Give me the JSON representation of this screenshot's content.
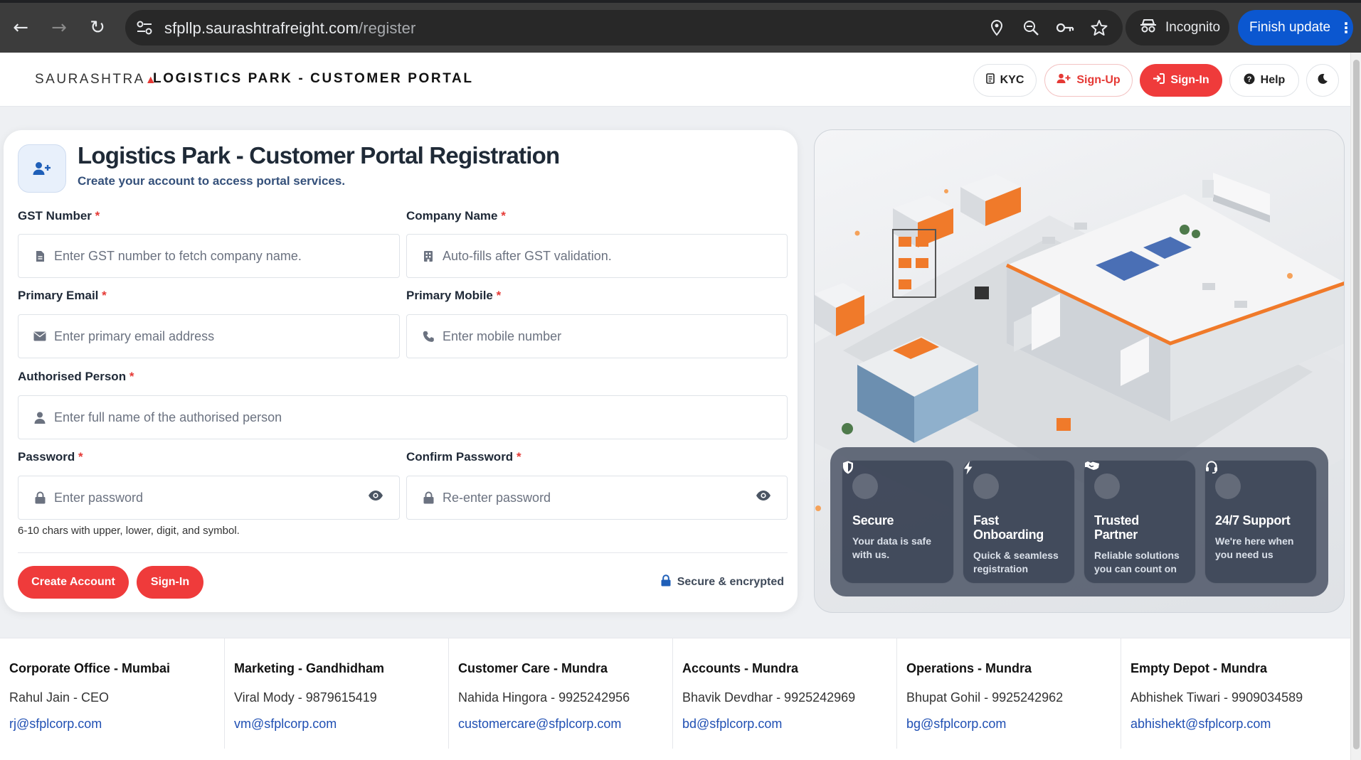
{
  "browser": {
    "url_host": "sfpllp.saurashtrafreight.com",
    "url_path": "/register",
    "incognito_label": "Incognito",
    "update_label": "Finish update",
    "icons": [
      "back-icon",
      "forward-icon",
      "reload-icon",
      "site-settings-icon",
      "location-icon",
      "zoom-icon",
      "key-icon",
      "star-icon",
      "incognito-icon",
      "more-vert-icon"
    ]
  },
  "header": {
    "logo": "SAURASHTRA",
    "portal_title": "LOGISTICS PARK - CUSTOMER PORTAL",
    "kyc": "KYC",
    "signup": "Sign-Up",
    "signin": "Sign-In",
    "help": "Help",
    "accent_color": "#ef3b3b"
  },
  "form": {
    "title": "Logistics Park - Customer Portal Registration",
    "subtitle": "Create your account to access portal services.",
    "required_mark": "*",
    "gst_label": "GST Number",
    "gst_placeholder": "Enter GST number to fetch company name.",
    "company_label": "Company Name",
    "company_placeholder": "Auto-fills after GST validation.",
    "email_label": "Primary Email",
    "email_placeholder": "Enter primary email address",
    "mobile_label": "Primary Mobile",
    "mobile_placeholder": "Enter mobile number",
    "person_label": "Authorised Person",
    "person_placeholder": "Enter full name of the authorised person",
    "password_label": "Password",
    "password_placeholder": "Enter password",
    "confirm_label": "Confirm Password",
    "confirm_placeholder": "Re-enter password",
    "password_hint": "6-10 chars with upper, lower, digit, and symbol.",
    "create_button": "Create Account",
    "signin_button": "Sign-In",
    "secure_note": "Secure & encrypted"
  },
  "features": [
    {
      "title": "Secure",
      "desc": "Your data is safe with us.",
      "icon": "shield-icon"
    },
    {
      "title": "Fast Onboarding",
      "desc": "Quick & seamless registration",
      "icon": "bolt-icon"
    },
    {
      "title": "Trusted Partner",
      "desc": "Reliable solutions you can count on",
      "icon": "handshake-icon"
    },
    {
      "title": "24/7 Support",
      "desc": "We're here when you need us",
      "icon": "headset-icon"
    }
  ],
  "footer": [
    {
      "title": "Corporate Office - Mumbai",
      "person": "Rahul Jain - CEO",
      "email": "rj@sfplcorp.com"
    },
    {
      "title": "Marketing - Gandhidham",
      "person": "Viral Mody - 9879615419",
      "email": "vm@sfplcorp.com"
    },
    {
      "title": "Customer Care - Mundra",
      "person": "Nahida Hingora - 9925242956",
      "email": "customercare@sfplcorp.com"
    },
    {
      "title": "Accounts - Mundra",
      "person": "Bhavik Devdhar - 9925242969",
      "email": "bd@sfplcorp.com"
    },
    {
      "title": "Operations - Mundra",
      "person": "Bhupat Gohil - 9925242962",
      "email": "bg@sfplcorp.com"
    },
    {
      "title": "Empty Depot - Mundra",
      "person": "Abhishek Tiwari - 9909034589",
      "email": "abhishekt@sfplcorp.com"
    }
  ]
}
